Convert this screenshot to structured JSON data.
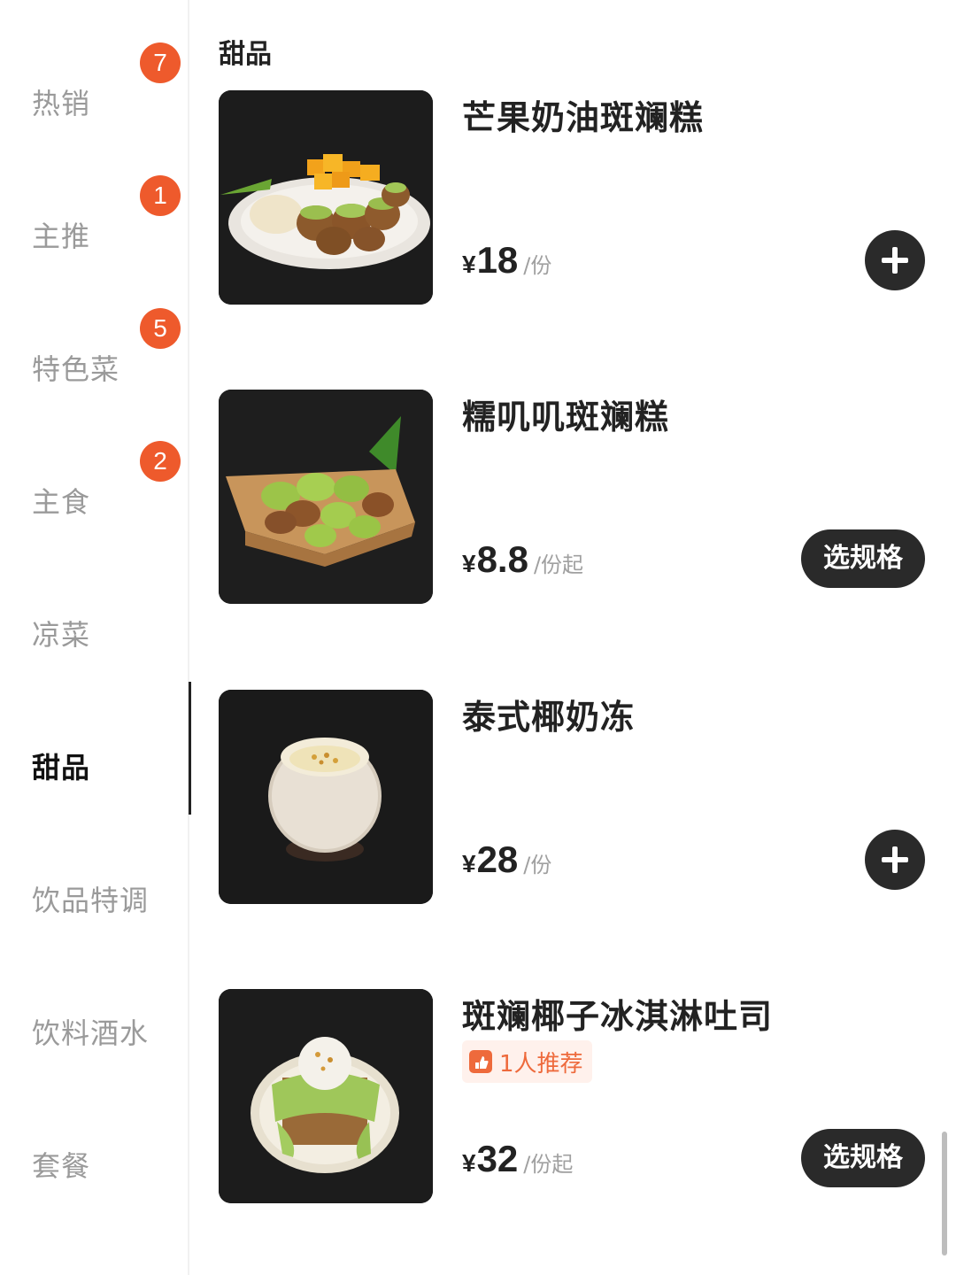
{
  "sidebar": {
    "categories": [
      {
        "label": "热销",
        "badge": "7"
      },
      {
        "label": "主推",
        "badge": "1"
      },
      {
        "label": "特色菜",
        "badge": "5"
      },
      {
        "label": "主食",
        "badge": "2"
      },
      {
        "label": "凉菜"
      },
      {
        "label": "甜品",
        "active": true
      },
      {
        "label": "饮品特调"
      },
      {
        "label": "饮料酒水"
      },
      {
        "label": "套餐"
      }
    ]
  },
  "main": {
    "section_title": "甜品",
    "items": [
      {
        "name": "芒果奶油斑斓糕",
        "yen": "¥",
        "price": "18",
        "unit": "/份",
        "action": "add"
      },
      {
        "name": "糯叽叽斑斓糕",
        "yen": "¥",
        "price": "8.8",
        "unit": "/份起",
        "action": "spec",
        "action_label": "选规格"
      },
      {
        "name": "泰式椰奶冻",
        "yen": "¥",
        "price": "28",
        "unit": "/份",
        "action": "add"
      },
      {
        "name": "斑斓椰子冰淇淋吐司",
        "tag": "1人推荐",
        "yen": "¥",
        "price": "32",
        "unit": "/份起",
        "action": "spec",
        "action_label": "选规格"
      }
    ]
  },
  "colors": {
    "badge": "#ee5a2c",
    "button": "#2a2a2a",
    "tag_text": "#ee6a3c",
    "tag_bg": "#fff1ec"
  },
  "icons": {
    "add": "plus-circle-icon",
    "recommend": "thumb-recommend-icon"
  }
}
